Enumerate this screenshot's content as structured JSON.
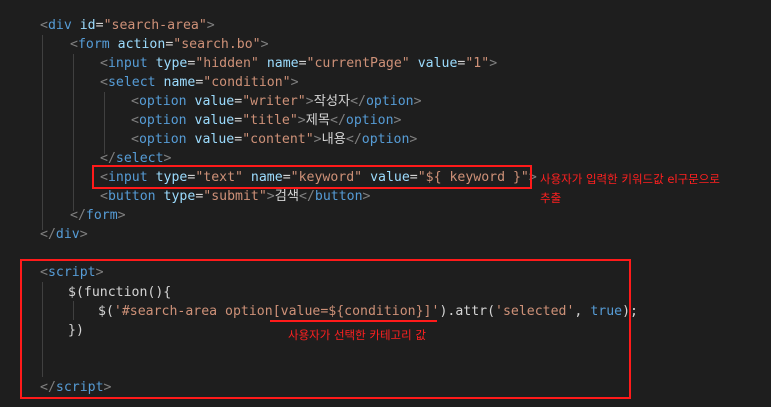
{
  "code": {
    "l1": {
      "tag": "div",
      "attr": "id",
      "val": "\"search-area\""
    },
    "l2": {
      "tag": "form",
      "attr": "action",
      "val": "\"search.bo\""
    },
    "l3": {
      "tag": "input",
      "a1": "type",
      "v1": "\"hidden\"",
      "a2": "name",
      "v2": "\"currentPage\"",
      "a3": "value",
      "v3": "\"1\""
    },
    "l4": {
      "tag": "select",
      "attr": "name",
      "val": "\"condition\""
    },
    "l5": {
      "tag": "option",
      "attr": "value",
      "val": "\"writer\"",
      "text": "작성자",
      "close": "option"
    },
    "l6": {
      "tag": "option",
      "attr": "value",
      "val": "\"title\"",
      "text": "제목",
      "close": "option"
    },
    "l7": {
      "tag": "option",
      "attr": "value",
      "val": "\"content\"",
      "text": "내용",
      "close": "option"
    },
    "l8": {
      "close": "select"
    },
    "l9": {
      "tag": "input",
      "a1": "type",
      "v1": "\"text\"",
      "a2": "name",
      "v2": "\"keyword\"",
      "a3": "value",
      "v3": "\"${ keyword }\""
    },
    "l10": {
      "tag": "button",
      "attr": "type",
      "val": "\"submit\"",
      "text": "검색",
      "close": "button"
    },
    "l11": {
      "close": "form"
    },
    "l12": {
      "close": "div"
    },
    "l14": {
      "tag": "script"
    },
    "l15": {
      "text": "$(function(){"
    },
    "l16": {
      "fn": "$(",
      "sel_a": "'#search-area option",
      "sel_b": "[value=${condition}]",
      "sel_c": "'",
      "mid": ").attr(",
      "arg": "'selected'",
      "comma": ", ",
      "kw": "true",
      "end": ");"
    },
    "l17": {
      "text": "})"
    },
    "l20": {
      "close": "script"
    }
  },
  "annotations": {
    "keyword_note_1": "사용자가 입력한 키워드값 el구문으로",
    "keyword_note_2": "추출",
    "condition_note": "사용자가 선택한 카테고리 값"
  },
  "colors": {
    "background": "#1e1e1e",
    "highlight": "#ff1a1a",
    "tag": "#569cd6",
    "attribute": "#9cdcfe",
    "string": "#ce9178"
  }
}
